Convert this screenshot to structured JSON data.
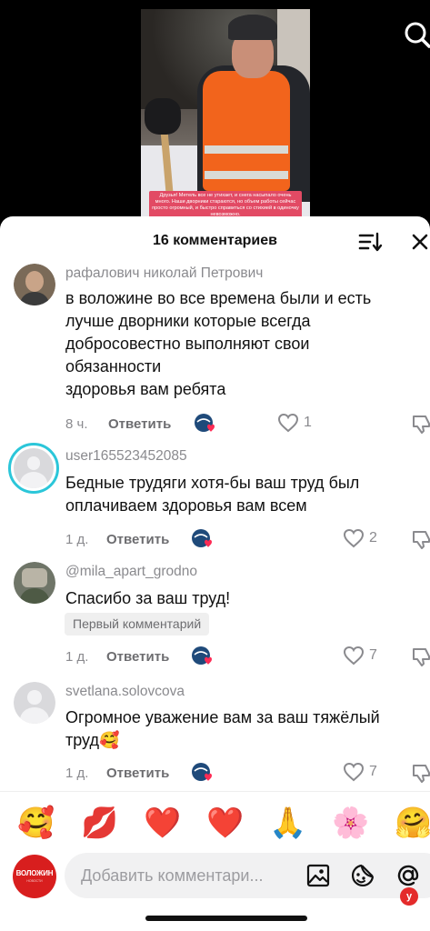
{
  "video": {
    "caption": "Друзья! Метель все не утихает, и снега насыпало очень много. Наши дворники стараются, но объем работы сейчас просто огромный, и быстро справиться со стихией в одиночку невозможно."
  },
  "sheet": {
    "title": "16 комментариев"
  },
  "comments": [
    {
      "username": "рафалович николай Петрович",
      "text_lines": [
        "в воложине во все времена были и есть",
        "лучше дворники которые всегда",
        "добросовестно выполняют свои",
        "обязанности",
        "здоровья вам ребята"
      ],
      "time": "8 ч.",
      "reply_label": "Ответить",
      "likes": "1"
    },
    {
      "username": "user165523452085",
      "text_lines": [
        "Бедные трудяги хотя-бы ваш труд был",
        "оплачиваем здоровья вам всем"
      ],
      "time": "1 д.",
      "reply_label": "Ответить",
      "likes": "2"
    },
    {
      "username": "@mila_apart_grodno",
      "text_lines": [
        "Спасибо за ваш труд!"
      ],
      "badge": "Первый комментарий",
      "time": "1 д.",
      "reply_label": "Ответить",
      "likes": "7"
    },
    {
      "username": "svetlana.solovcova",
      "text_lines": [
        "Огромное уважение вам за ваш тяжёлый",
        "труд🥰"
      ],
      "time": "1 д.",
      "reply_label": "Ответить",
      "likes": "7"
    }
  ],
  "emoji_bar": [
    "🥰",
    "💋",
    "❤️",
    "❤️",
    "🙏",
    "🌸",
    "🤗"
  ],
  "input": {
    "placeholder": "Добавить комментари...",
    "logo_text": "ВОЛОЖИН",
    "logo_sub": "НОВОСТИ"
  },
  "watermark": "у",
  "colors": {
    "accent_ring": "#2bc6d9",
    "creator_heart": "#fe2c55",
    "logo_red": "#d81e1e"
  }
}
